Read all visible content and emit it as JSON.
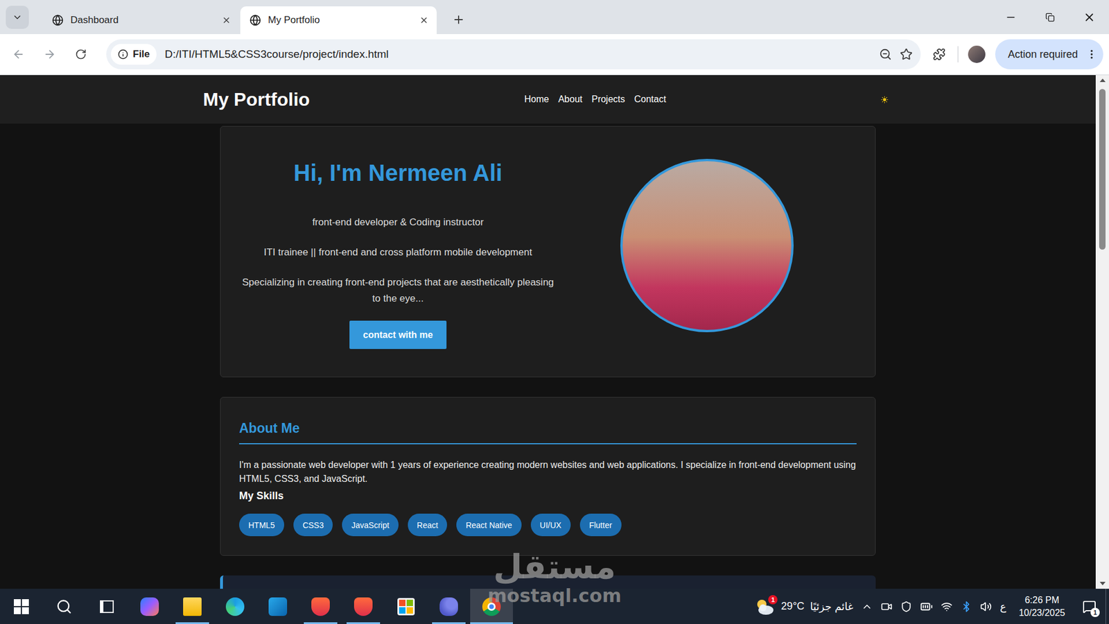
{
  "browser": {
    "tabs": [
      {
        "label": "Dashboard",
        "selected": false
      },
      {
        "label": "My Portfolio",
        "selected": true
      }
    ],
    "address": {
      "chip": "File",
      "url": "D:/ITI/HTML5&CSS3course/project/index.html"
    },
    "action_button": "Action required"
  },
  "page": {
    "header": {
      "logo": "My Portfolio",
      "nav": [
        "Home",
        "About",
        "Projects",
        "Contact"
      ]
    },
    "hero": {
      "title": "Hi, I'm Nermeen Ali",
      "lines": [
        "front-end developer & Coding instructor",
        "ITI trainee || front-end and cross platform mobile development",
        "Specializing in creating front-end projects that are aesthetically pleasing to the eye..."
      ],
      "button": "contact with me"
    },
    "about": {
      "title": "About Me",
      "text": "I'm a passionate web developer with 1 years of experience creating modern websites and web applications. I specialize in front-end development using HTML5, CSS3, and JavaScript.",
      "skills_title": "My Skills",
      "skills": [
        "HTML5",
        "CSS3",
        "JavaScript",
        "React",
        "React Native",
        "UI/UX",
        "Flutter"
      ]
    },
    "scrollbar": {
      "level": 0.33
    }
  },
  "taskbar": {
    "apps": [
      {
        "kind": "copilot",
        "running": false,
        "selected": false
      },
      {
        "kind": "explorer",
        "running": true,
        "selected": false
      },
      {
        "kind": "edge",
        "running": false,
        "selected": false
      },
      {
        "kind": "outlook",
        "running": false,
        "selected": false
      },
      {
        "kind": "brave",
        "running": true,
        "selected": false
      },
      {
        "kind": "brave",
        "running": true,
        "selected": false
      },
      {
        "kind": "store",
        "running": false,
        "selected": false
      },
      {
        "kind": "teams",
        "running": true,
        "selected": false
      },
      {
        "kind": "chrome",
        "running": true,
        "selected": true
      }
    ],
    "weather": {
      "badge": "1",
      "temp": "29°C",
      "condition": "غائم جزئيًا"
    },
    "language": "ع",
    "clock": {
      "time": "6:26 PM",
      "date": "10/23/2025"
    },
    "notifications": "1"
  },
  "watermark": {
    "arabic": "مستقل",
    "latin": "mostaql.com"
  }
}
